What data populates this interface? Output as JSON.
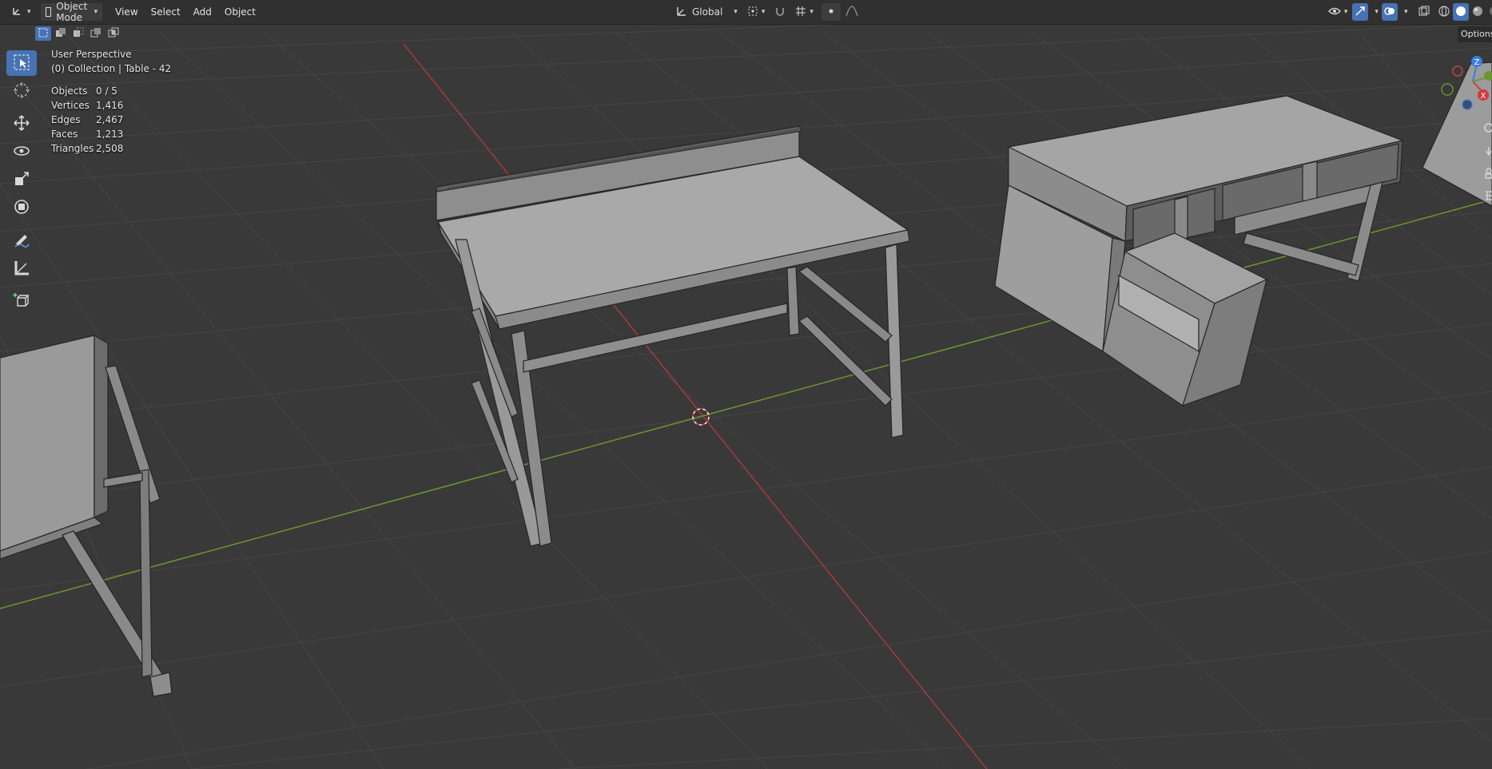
{
  "header": {
    "mode_label": "Object Mode",
    "menus": [
      "View",
      "Select",
      "Add",
      "Object"
    ],
    "transform_orientation": "Global"
  },
  "options_label": "Options",
  "overlay": {
    "view_name": "User Perspective",
    "collection": "(0) Collection | Table - 42",
    "stats": [
      {
        "label": "Objects",
        "value": "0 / 5"
      },
      {
        "label": "Vertices",
        "value": "1,416"
      },
      {
        "label": "Edges",
        "value": "2,467"
      },
      {
        "label": "Faces",
        "value": "1,213"
      },
      {
        "label": "Triangles",
        "value": "2,508"
      }
    ]
  },
  "gizmo": {
    "x": "X",
    "z": "Z"
  },
  "colors": {
    "accent": "#4772b3",
    "viewport_bg": "#3a3a3a",
    "x_axis": "#a83a3e",
    "y_axis": "#6e9630",
    "z_axis": "#3a7de0"
  },
  "tools": [
    "select-box-icon",
    "cursor-icon",
    "move-icon",
    "rotate-icon",
    "scale-icon",
    "transform-icon",
    "annotate-icon",
    "measure-icon",
    "add-cube-icon"
  ]
}
